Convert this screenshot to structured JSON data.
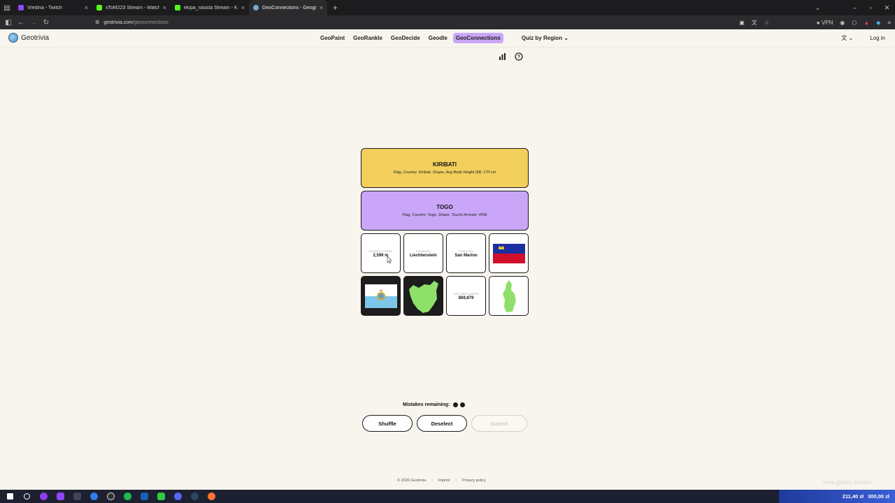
{
  "browser": {
    "tabs": [
      {
        "title": "Vredina - Twitch",
        "color": "#9146ff",
        "active": false
      },
      {
        "title": "xToM223 Stream - Watch Li",
        "color": "#53fc18",
        "active": false
      },
      {
        "title": "ekipa_rasista Stream - Kick Da",
        "color": "#53fc18",
        "active": false
      },
      {
        "title": "GeoConnections - Geography C",
        "color": "#7fa7c9",
        "active": true
      }
    ],
    "url_host": "geotrivia.com",
    "url_path": "/geoconnections",
    "vpn_label": "VPN"
  },
  "site": {
    "logo_text": "Geotrivia",
    "nav": [
      {
        "label": "GeoPaint",
        "active": false
      },
      {
        "label": "GeoRankle",
        "active": false
      },
      {
        "label": "GeoDecide",
        "active": false
      },
      {
        "label": "Geodle",
        "active": false
      },
      {
        "label": "GeoConnections",
        "active": true
      }
    ],
    "region_label": "Quiz by Region",
    "login_label": "Log in"
  },
  "game": {
    "groups": [
      {
        "name": "KIRIBATI",
        "desc": "Flag, Country: Kiribati, Shape, Avg Body Height (M): 170 cm",
        "color": "#f3cf5c"
      },
      {
        "name": "TOGO",
        "desc": "Flag, Country: Togo, Shape, Tourist Arrivals: 450k",
        "color": "#c9a6f7"
      }
    ],
    "tiles": [
      {
        "kind": "text",
        "label": "HIGHEST POINT",
        "value": "2,599 m"
      },
      {
        "kind": "text",
        "label": "COUNTRY",
        "value": "Liechtenstein"
      },
      {
        "kind": "text",
        "label": "COUNTRY",
        "value": "San Marino"
      },
      {
        "kind": "flag-liechtenstein"
      },
      {
        "kind": "flag-sanmarino"
      },
      {
        "kind": "shape-dark"
      },
      {
        "kind": "text",
        "label": "GDP PER CAPITA",
        "value": "$69,879"
      },
      {
        "kind": "shape-light"
      }
    ],
    "mistakes_label": "Mistakes remaining:",
    "mistakes_remaining": 2,
    "buttons": {
      "shuffle": "Shuffle",
      "deselect": "Deselect",
      "submit": "Submit"
    }
  },
  "footer": {
    "copyright": "© 2026 Geotrivia",
    "imprint": "Imprint",
    "privacy": "Privacy policy"
  },
  "taskbar": {
    "balance_1": "211,40 zł",
    "balance_2": "300,00 zł",
    "watermark": "www.glarkin.stream"
  }
}
